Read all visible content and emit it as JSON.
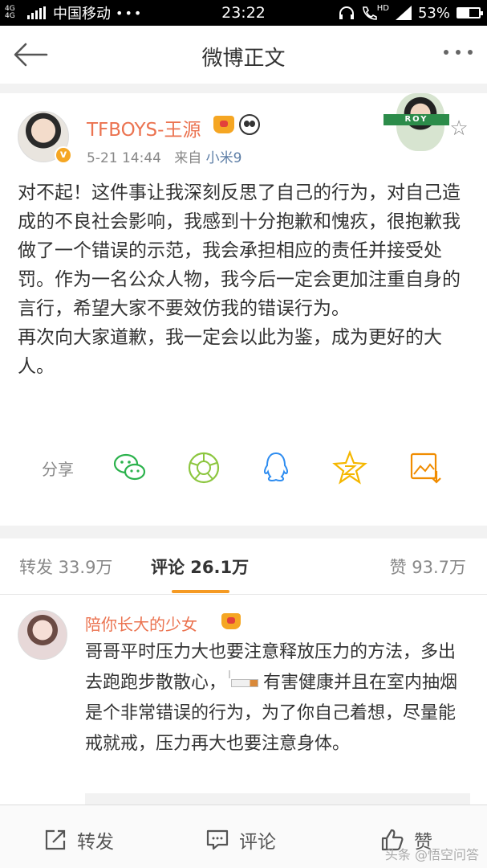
{
  "status_bar": {
    "network": "4G 4G",
    "carrier": "中国移动",
    "time": "23:22",
    "hd": "HD",
    "battery": "53%",
    "battery_level": 0.53
  },
  "nav": {
    "title": "微博正文"
  },
  "post": {
    "author": "TFBOYS-王源",
    "time": "5-21 14:44",
    "source_prefix": "来自",
    "source": "小米9",
    "badge_text": "ROY",
    "paragraphs": [
      "对不起！这件事让我深刻反思了自己的行为，对自己造成的不良社会影响，我感到十分抱歉和愧疚，很抱歉我做了一个错误的示范，我会承担相应的责任并接受处罚。作为一名公众人物，我今后一定会更加注重自身的言行，希望大家不要效仿我的错误行为。",
      "再次向大家道歉，我一定会以此为鉴，成为更好的大人。"
    ],
    "share_label": "分享"
  },
  "tabs": {
    "repost": "转发 33.9万",
    "comment": "评论 26.1万",
    "like": "赞 93.7万"
  },
  "comment": {
    "author": "陪你长大的少女",
    "text_part1": "哥哥平时压力大也要注意释放压力的方法，多出去跑跑步散散心，",
    "text_part2": "有害健康并且在室内抽烟是个非常错误的行为，为了你自己着想，尽量能戒就戒，压力再大也要注意身体。"
  },
  "bottom_bar": {
    "repost": "转发",
    "comment": "评论",
    "like": "赞",
    "watermark": "头条 @悟空问答"
  },
  "colors": {
    "accent_orange": "#eb7350",
    "tab_underline": "#f59a23",
    "link_blue": "#5d7ea6"
  }
}
